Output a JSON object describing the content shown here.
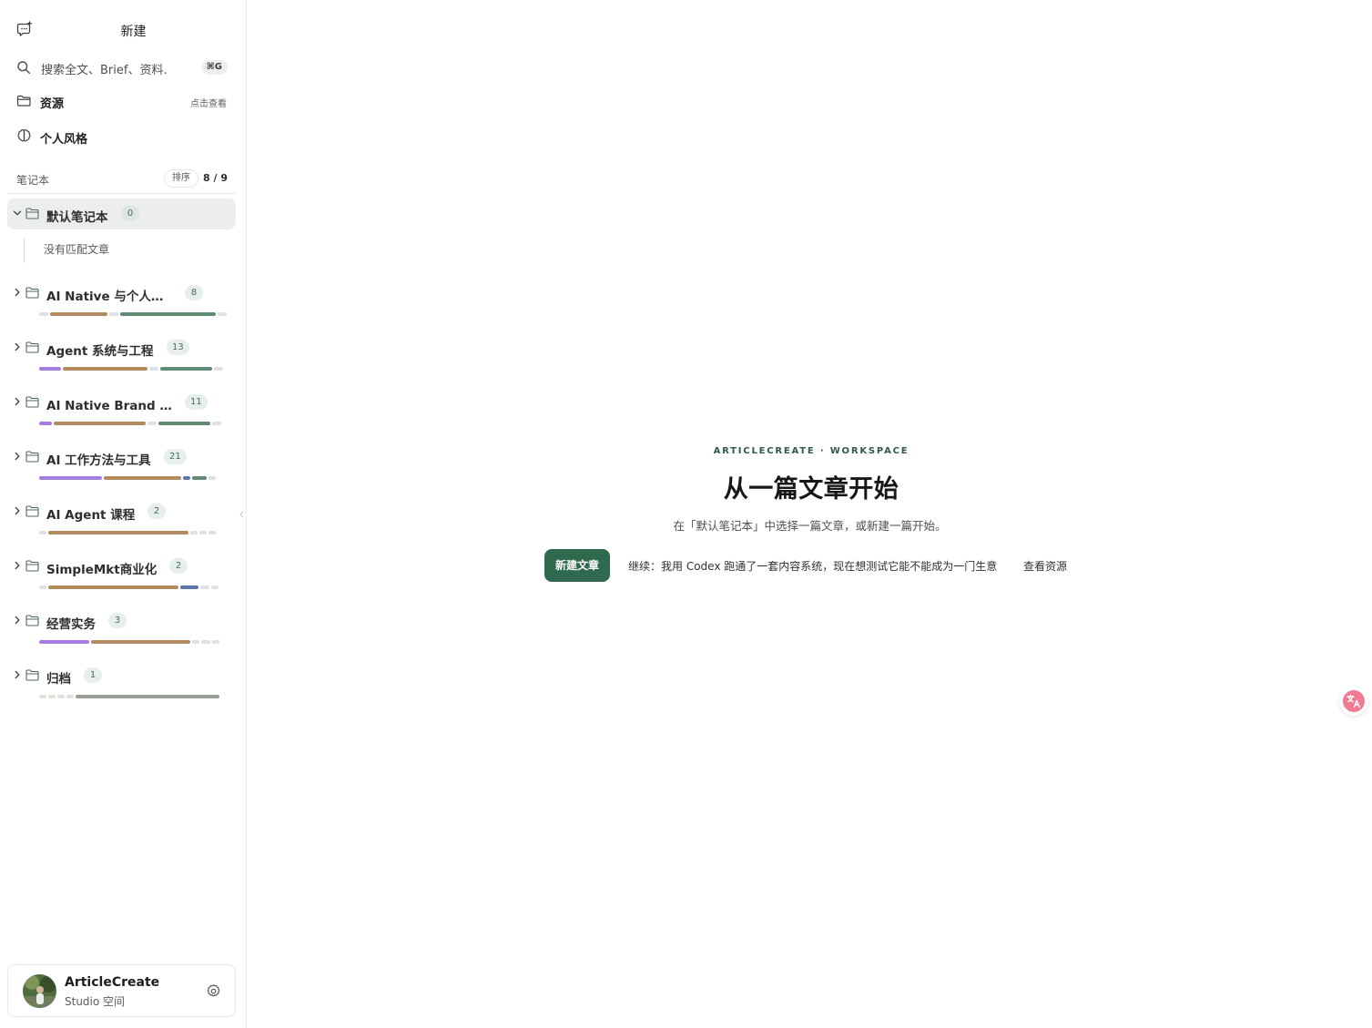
{
  "sidebar": {
    "new_label": "新建",
    "search": {
      "placeholder": "搜索全文、Brief、资料.",
      "shortcut": "⌘G"
    },
    "resources": {
      "label": "资源",
      "hint": "点击查看"
    },
    "personal_style": {
      "label": "个人风格"
    },
    "notebooks_header": {
      "title": "笔记本",
      "sort_label": "排序",
      "count": "8 / 9"
    },
    "notebooks": [
      {
        "name": "默认笔记本",
        "count": "0",
        "expanded": true,
        "empty_text": "没有匹配文章",
        "progress": []
      },
      {
        "name": "AI Native 与个人进化",
        "count": "8",
        "expanded": false,
        "progress": [
          {
            "color": "#dde1e6",
            "w": 0.05
          },
          {
            "color": "#b28a5e",
            "w": 0.32
          },
          {
            "color": "#dde1e6",
            "w": 0.05
          },
          {
            "color": "#5f8a74",
            "w": 0.53
          },
          {
            "color": "#dde1e6",
            "w": 0.05
          }
        ]
      },
      {
        "name": "Agent 系统与工程",
        "count": "13",
        "expanded": false,
        "progress": [
          {
            "color": "#a57be8",
            "w": 0.12
          },
          {
            "color": "#b28a5e",
            "w": 0.47
          },
          {
            "color": "#dde1e6",
            "w": 0.05
          },
          {
            "color": "#5f8a74",
            "w": 0.29
          },
          {
            "color": "#dde1e6",
            "w": 0.05
          }
        ]
      },
      {
        "name": "AI Native Brand 与...",
        "count": "11",
        "expanded": false,
        "progress": [
          {
            "color": "#a57be8",
            "w": 0.07
          },
          {
            "color": "#b28a5e",
            "w": 0.51
          },
          {
            "color": "#dde1e6",
            "w": 0.05
          },
          {
            "color": "#5f8a74",
            "w": 0.29
          },
          {
            "color": "#dde1e6",
            "w": 0.05
          }
        ]
      },
      {
        "name": "AI 工作方法与工具",
        "count": "21",
        "expanded": false,
        "progress": [
          {
            "color": "#a57be8",
            "w": 0.35
          },
          {
            "color": "#b28a5e",
            "w": 0.43
          },
          {
            "color": "#5a77a8",
            "w": 0.04
          },
          {
            "color": "#5f8a74",
            "w": 0.08
          },
          {
            "color": "#dde1e6",
            "w": 0.04
          }
        ]
      },
      {
        "name": "AI Agent 课程",
        "count": "2",
        "expanded": false,
        "progress": [
          {
            "color": "#dde1e6",
            "w": 0.04
          },
          {
            "color": "#b28a5e",
            "w": 0.78
          },
          {
            "color": "#dde1e6",
            "w": 0.04
          },
          {
            "color": "#dde1e6",
            "w": 0.04
          },
          {
            "color": "#dde1e6",
            "w": 0.04
          }
        ]
      },
      {
        "name": "SimpleMkt商业化",
        "count": "2",
        "expanded": false,
        "progress": [
          {
            "color": "#dde1e6",
            "w": 0.04
          },
          {
            "color": "#b28a5e",
            "w": 0.72
          },
          {
            "color": "#5a77a8",
            "w": 0.1
          },
          {
            "color": "#dde1e6",
            "w": 0.05
          },
          {
            "color": "#dde1e6",
            "w": 0.04
          }
        ]
      },
      {
        "name": "经营实务",
        "count": "3",
        "expanded": false,
        "progress": [
          {
            "color": "#a57be8",
            "w": 0.28
          },
          {
            "color": "#b28a5e",
            "w": 0.55
          },
          {
            "color": "#dde1e6",
            "w": 0.04
          },
          {
            "color": "#dde1e6",
            "w": 0.05
          },
          {
            "color": "#dde1e6",
            "w": 0.04
          }
        ]
      },
      {
        "name": "归档",
        "count": "1",
        "expanded": false,
        "progress": [
          {
            "color": "#dde1e6",
            "w": 0.04
          },
          {
            "color": "#e3e6cf",
            "w": 0.04
          },
          {
            "color": "#dde1e6",
            "w": 0.04
          },
          {
            "color": "#dde1e6",
            "w": 0.04
          },
          {
            "color": "#98a096",
            "w": 0.8
          }
        ]
      }
    ],
    "profile": {
      "name": "ArticleCreate",
      "subtitle": "Studio 空间"
    }
  },
  "main": {
    "eyebrow": "ARTICLECREATE · WORKSPACE",
    "headline": "从一篇文章开始",
    "subline": "在「默认笔记本」中选择一篇文章，或新建一篇开始。",
    "primary_button": "新建文章",
    "continue_link": "继续：我用 Codex 跑通了一套内容系统，现在想测试它能不能成为一门生意",
    "resources_link": "查看资源"
  },
  "colors": {
    "accent": "#2f6a4f",
    "progress_purple": "#a57be8",
    "progress_brown": "#b28a5e",
    "progress_green": "#5f8a74",
    "progress_blue": "#5a77a8",
    "progress_track": "#dde1e6",
    "badge_bg": "#e6efe9",
    "translate_fab": "#ef7b93"
  },
  "icons": {
    "new": "chat-plus-icon",
    "search": "search-icon",
    "resources": "folder-icon",
    "personal_style": "brain-icon",
    "notebook": "folder-icon",
    "settings": "gear-icon",
    "translate": "translate-icon"
  }
}
